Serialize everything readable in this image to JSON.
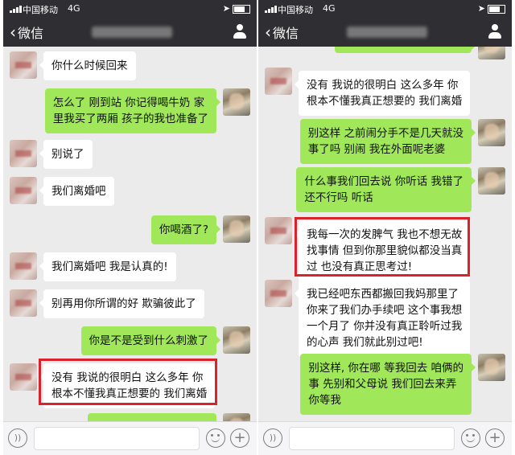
{
  "status_bar": {
    "carrier": "中国移动",
    "network": "4G"
  },
  "nav": {
    "back_label": "微信"
  },
  "left_panel": {
    "messages": [
      {
        "side": "in",
        "text": "你什么时候回来"
      },
      {
        "side": "out",
        "text": "怎么了 刚到站 你记得喝牛奶 家\n里我买了两厢 孩子的我也准备了"
      },
      {
        "side": "in",
        "text": "别说了"
      },
      {
        "side": "in",
        "text": "我们离婚吧"
      },
      {
        "side": "out",
        "text": "你喝酒了?"
      },
      {
        "side": "in",
        "text": "我们离婚吧 我是认真的!"
      },
      {
        "side": "in",
        "text": "别再用你所谓的好 欺骗彼此了"
      },
      {
        "side": "out",
        "text": "你是不是受到什么刺激了"
      },
      {
        "side": "in",
        "text": "没有 我说的很明白 这么多年 你\n根本不懂我真正想要的 我们离婚",
        "highlighted": true
      }
    ]
  },
  "right_panel": {
    "messages": [
      {
        "side": "in",
        "text": "没有 我说的很明白 这么多年 你\n根本不懂我真正想要的 我们离婚"
      },
      {
        "side": "out",
        "text": "别这样 之前闹分手不是几天就没\n事了吗 别闹 我在外面呢老婆"
      },
      {
        "side": "out",
        "text": "什么事我们回去说 你听话 我错了\n还不行吗 听话"
      },
      {
        "side": "in",
        "text": "我每一次的发脾气 我也不想无故\n找事情 但到你那里貌似都没当真\n过 也没有真正思考过!",
        "highlighted": true
      },
      {
        "side": "in",
        "text": "我已经吧东西都搬回我妈那里了\n你来了我们办手续吧 这个事我想\n一个月了 你并没有真正聆听过我\n的心声 我们就此别过吧!"
      },
      {
        "side": "out",
        "text": "别这样, 你在哪 等我回去 咱俩的\n事 先别和父母说 我们回去来弄\n你等我"
      }
    ]
  },
  "icons": [
    "signal-icon",
    "chevron-left-icon",
    "person-icon",
    "voice-icon",
    "emoji-icon",
    "plus-icon",
    "battery-icon",
    "location-icon"
  ],
  "colors": {
    "header_bg": "#2e2e33",
    "chat_bg": "#ebebeb",
    "outgoing_bubble": "#a0e75a",
    "incoming_bubble": "#ffffff",
    "highlight": "#d8232a"
  }
}
